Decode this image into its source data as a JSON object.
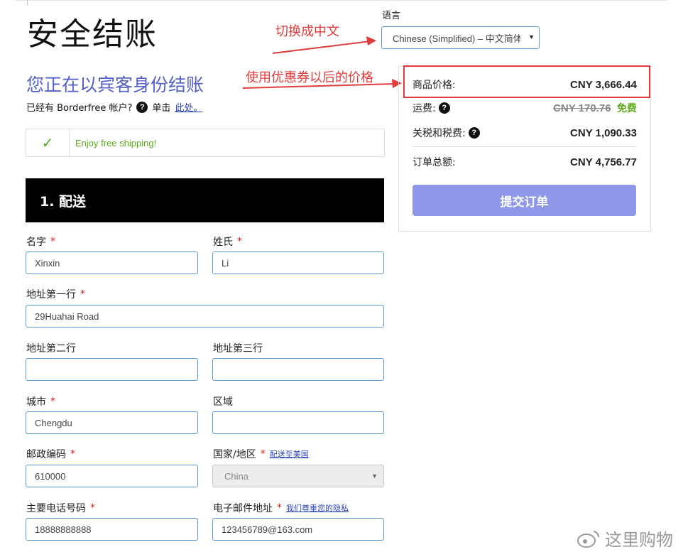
{
  "page": {
    "title": "安全结账",
    "guest_title": "您正在以宾客身份结账",
    "account_prompt": "已经有 Borderfree 帐户?",
    "click_prefix": "单击",
    "click_link": "此处。"
  },
  "shipping_notice": "Enjoy free shipping!",
  "section": {
    "title": "1. 配送"
  },
  "form": {
    "first_name": {
      "label": "名字",
      "value": "Xinxin"
    },
    "last_name": {
      "label": "姓氏",
      "value": "Li"
    },
    "address1": {
      "label": "地址第一行",
      "value": "29Huahai Road"
    },
    "address2": {
      "label": "地址第二行",
      "value": ""
    },
    "address3": {
      "label": "地址第三行",
      "value": ""
    },
    "city": {
      "label": "城市",
      "value": "Chengdu"
    },
    "region": {
      "label": "区域",
      "value": ""
    },
    "postal": {
      "label": "邮政编码",
      "value": "610000"
    },
    "country": {
      "label": "国家/地区",
      "link": "配送至美国",
      "value": "China"
    },
    "phone": {
      "label": "主要电话号码",
      "value": "18888888888"
    },
    "email": {
      "label": "电子邮件地址",
      "link": "我们尊重您的隐私",
      "value": "123456789@163.com"
    },
    "required_mark": "*"
  },
  "language": {
    "label": "语言",
    "selected": "Chinese (Simplified) – 中文简体"
  },
  "annotations": {
    "switch_chinese": "切换成中文",
    "after_coupon": "使用优惠券以后的价格"
  },
  "summary": {
    "item_price": {
      "label": "商品价格:",
      "value": "CNY 3,666.44"
    },
    "shipping": {
      "label": "运费:",
      "old_value": "CNY 170.76",
      "free": "免费"
    },
    "duties": {
      "label": "关税和税费:",
      "value": "CNY 1,090.33"
    },
    "total": {
      "label": "订单总额:",
      "value": "CNY 4,756.77"
    },
    "submit": "提交订单"
  },
  "icons": {
    "help": "?",
    "check": "✓",
    "dropdown": "▼"
  },
  "watermark": "这里购物",
  "colors": {
    "accent_blue": "#5461c8",
    "submit_bg": "#8f97e8",
    "annotation_red": "#e23b3b",
    "free_green": "#5eaa1e"
  }
}
